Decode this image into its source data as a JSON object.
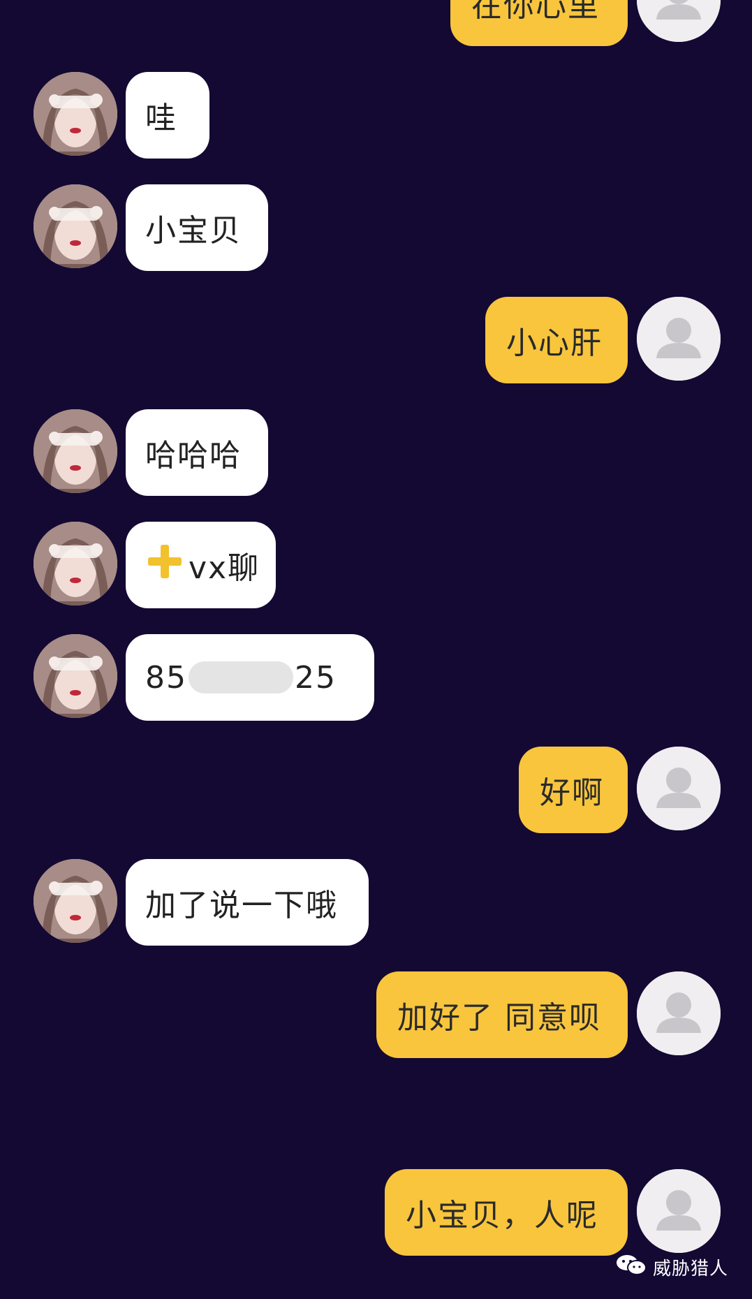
{
  "messages": [
    {
      "side": "out",
      "text": "在你心里"
    },
    {
      "side": "in",
      "text": "哇"
    },
    {
      "side": "in",
      "text": "小宝贝"
    },
    {
      "side": "out",
      "text": "小心肝"
    },
    {
      "side": "in",
      "text": "哈哈哈"
    },
    {
      "side": "in",
      "text": "vx聊",
      "prefix_icon": "yellow-plus-icon"
    },
    {
      "side": "in",
      "text_start": "8",
      "text_mid": "5",
      "text_end": "25",
      "redacted": true
    },
    {
      "side": "out",
      "text": "好啊"
    },
    {
      "side": "in",
      "text": "加了说一下哦"
    },
    {
      "side": "out",
      "text": "加好了 同意呗"
    },
    {
      "side": "out",
      "text": "小宝贝，人呢"
    }
  ],
  "watermark": {
    "text": "威胁猎人",
    "icon": "wechat-icon"
  },
  "colors": {
    "background": "#140933",
    "outgoing_bubble": "#f8c53d",
    "incoming_bubble": "#ffffff"
  }
}
